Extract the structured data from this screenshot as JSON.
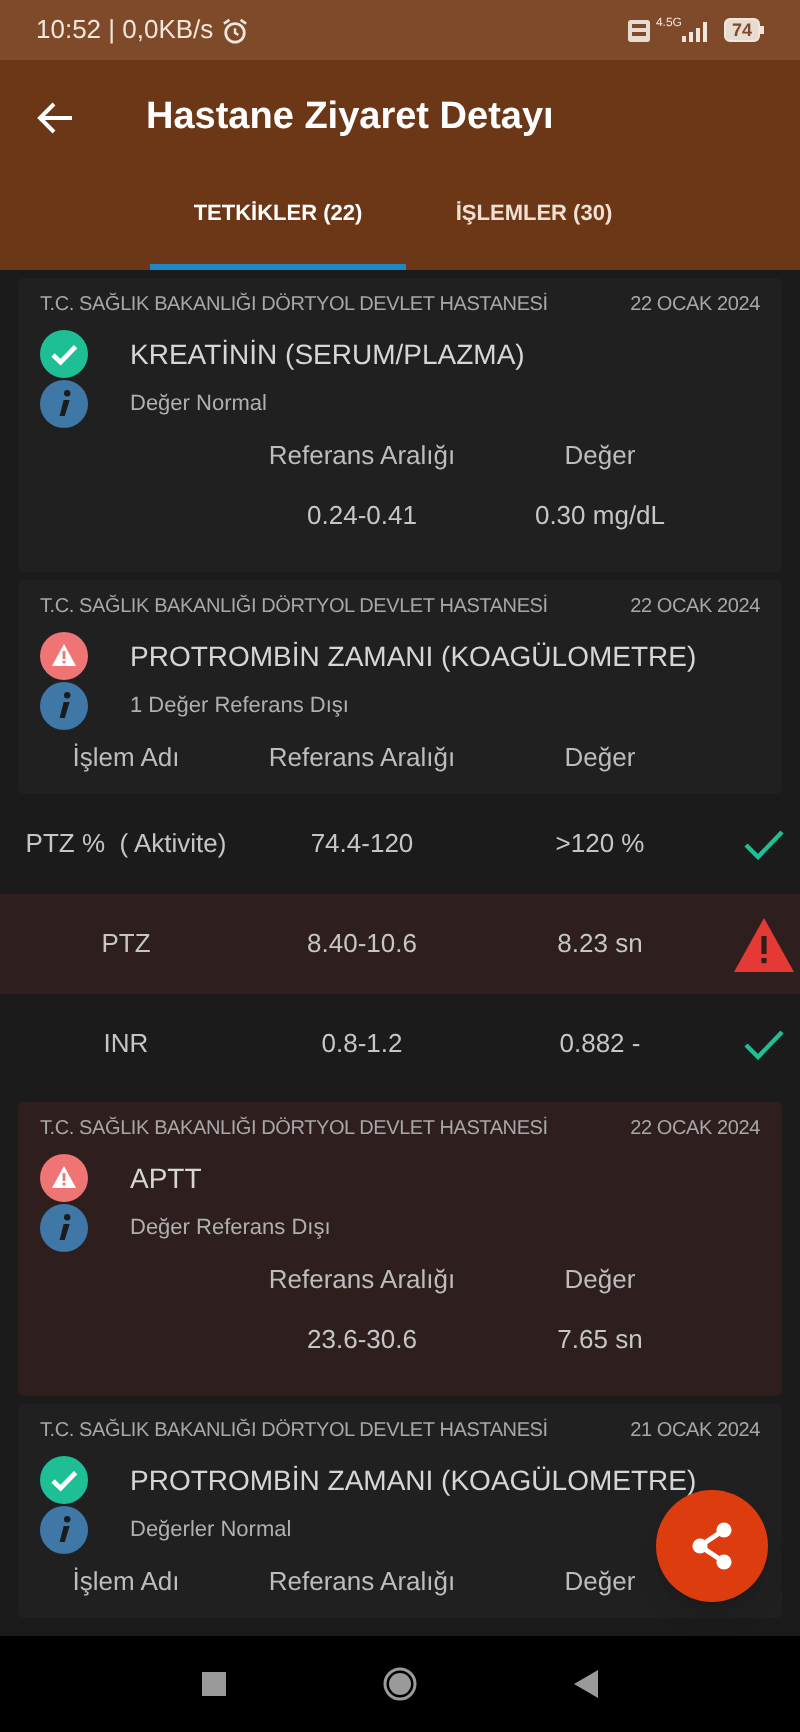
{
  "status_bar": {
    "time": "10:52 | 0,0KB/s",
    "network": "4.5G",
    "battery": "74"
  },
  "app_bar": {
    "title": "Hastane Ziyaret Detayı"
  },
  "tabs": [
    {
      "label": "TETKİKLER (22)",
      "selected": true
    },
    {
      "label": "İŞLEMLER (30)",
      "selected": false
    }
  ],
  "tests": [
    {
      "kind": "single",
      "out_of_range": false,
      "hospital": "T.C. SAĞLIK BAKANLIĞI DÖRTYOL DEVLET HASTANESİ",
      "date": "22 OCAK 2024",
      "name": "KREATİNİN (SERUM/PLAZMA)",
      "info": "Değer Normal",
      "columns": [
        "Referans Aralığı",
        "Değer"
      ],
      "rows": [
        {
          "range": "0.24-0.41",
          "value": "0.30 mg/dL"
        }
      ]
    },
    {
      "kind": "panel",
      "out_of_range": true,
      "hospital": "T.C. SAĞLIK BAKANLIĞI DÖRTYOL DEVLET HASTANESİ",
      "date": "22 OCAK 2024",
      "name": "PROTROMBİN ZAMANI (KOAGÜLOMETRE)",
      "info": "1 Değer Referans Dışı",
      "columns": [
        "İşlem Adı",
        "Referans Aralığı",
        "Değer"
      ],
      "rows": [
        {
          "name": "PTZ %  ( Aktivite)",
          "range": "74.4-120",
          "value": ">120 %",
          "out_of_range": false
        },
        {
          "name": "PTZ",
          "range": "8.40-10.6",
          "value": "8.23 sn",
          "out_of_range": true
        },
        {
          "name": "INR",
          "range": "0.8-1.2",
          "value": "0.882 -",
          "out_of_range": false
        }
      ]
    },
    {
      "kind": "single",
      "out_of_range": true,
      "hospital": "T.C. SAĞLIK BAKANLIĞI DÖRTYOL DEVLET HASTANESİ",
      "date": "22 OCAK 2024",
      "name": "APTT",
      "info": "Değer Referans Dışı",
      "columns": [
        "Referans Aralığı",
        "Değer"
      ],
      "rows": [
        {
          "range": "23.6-30.6",
          "value": "7.65 sn"
        }
      ]
    },
    {
      "kind": "panel",
      "out_of_range": false,
      "hospital": "T.C. SAĞLIK BAKANLIĞI DÖRTYOL DEVLET HASTANESİ",
      "date": "21 OCAK 2024",
      "name": "PROTROMBİN ZAMANI (KOAGÜLOMETRE)",
      "info": "Değerler Normal",
      "columns": [
        "İşlem Adı",
        "Referans Aralığı",
        "Değer"
      ]
    }
  ]
}
